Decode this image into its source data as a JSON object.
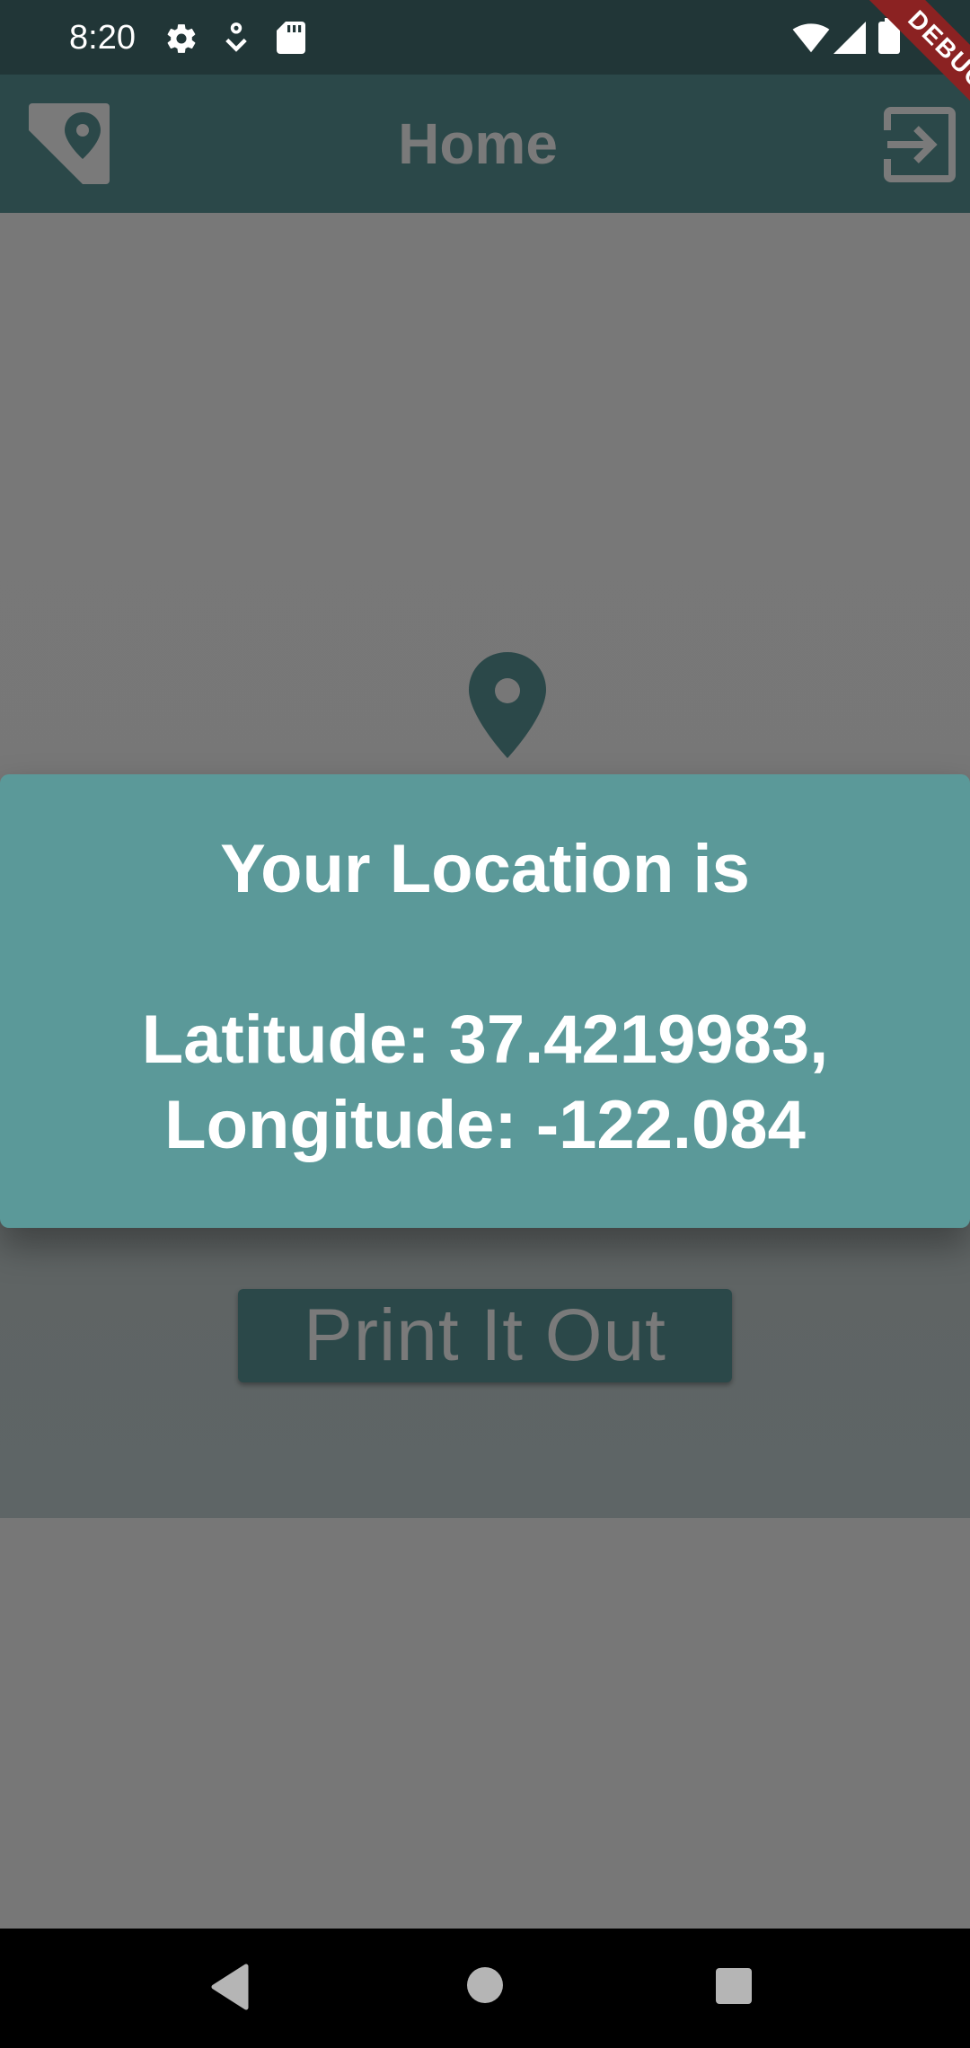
{
  "status_bar": {
    "time": "8:20",
    "icons": [
      "settings-icon",
      "download-icon",
      "sd-card-icon",
      "wifi-icon",
      "signal-icon",
      "battery-icon"
    ]
  },
  "debug_banner": {
    "label": "DEBUG"
  },
  "app_bar": {
    "title": "Home",
    "leading_icon": "map-pin-icon",
    "trailing_icon": "exit-icon"
  },
  "main": {
    "pin_icon": "location-pin-icon",
    "print_button_label": "Print It Out"
  },
  "dialog": {
    "title": "Your Location is",
    "latitude_line": "Latitude: 37.4219983,",
    "longitude_line": "Longitude: -122.084"
  },
  "nav_bar": {
    "buttons": [
      "back-icon",
      "home-icon",
      "recents-icon"
    ]
  },
  "colors": {
    "status_bar": "#213637",
    "app_bar": "#2b4849",
    "dialog": "#5b9999",
    "scrim": "#777777",
    "debug_banner": "#8b2222"
  }
}
